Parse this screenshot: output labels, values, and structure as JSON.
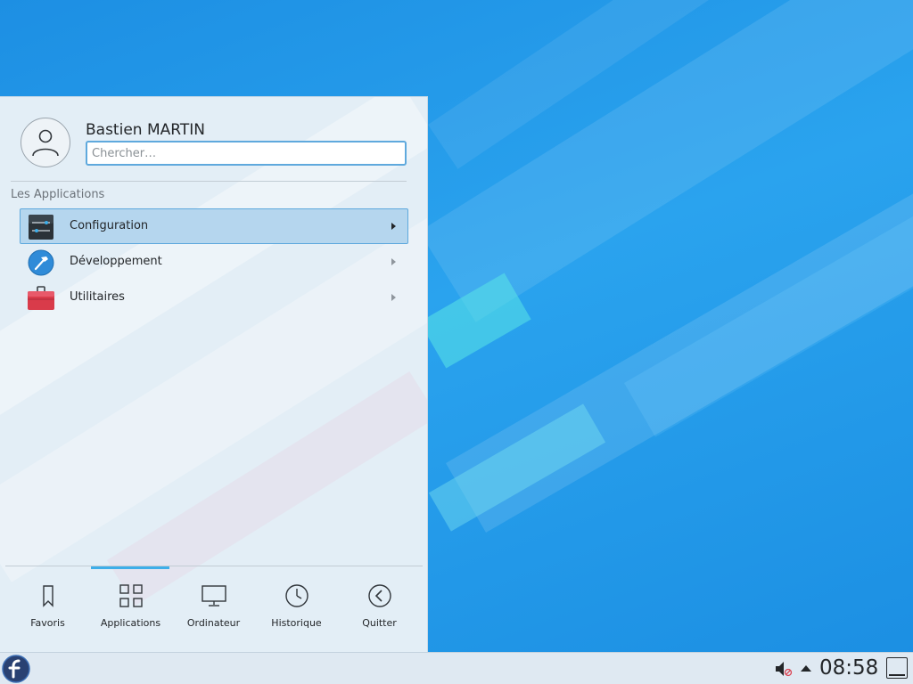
{
  "launcher": {
    "user_name": "Bastien MARTIN",
    "search_placeholder": "Chercher…",
    "section_title": "Les Applications",
    "apps": [
      {
        "label": "Configuration",
        "icon": "settings-sliders-icon"
      },
      {
        "label": "Développement",
        "icon": "hammer-icon"
      },
      {
        "label": "Utilitaires",
        "icon": "toolbox-icon"
      }
    ],
    "tabs": [
      {
        "label": "Favoris",
        "icon": "bookmark-icon"
      },
      {
        "label": "Applications",
        "icon": "grid-icon"
      },
      {
        "label": "Ordinateur",
        "icon": "monitor-icon"
      },
      {
        "label": "Historique",
        "icon": "clock-icon"
      },
      {
        "label": "Quitter",
        "icon": "back-arrow-icon"
      }
    ]
  },
  "taskbar": {
    "clock": "08:58",
    "launcher_icon": "fedora-logo-icon",
    "volume_icon": "volume-muted-icon"
  },
  "colors": {
    "accent": "#3daee9",
    "selection": "#b5d6ee",
    "desktop": "#1d8fe3"
  }
}
